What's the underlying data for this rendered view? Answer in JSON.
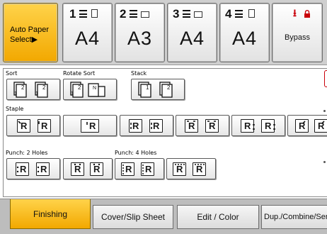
{
  "trays": [
    {
      "label": "Auto Paper\nSelect▶"
    },
    {
      "number": "1",
      "size": "A4"
    },
    {
      "number": "2",
      "size": "A3"
    },
    {
      "number": "3",
      "size": "A4"
    },
    {
      "number": "4",
      "size": "A4"
    },
    {
      "label": "Bypass",
      "icon": "bypass-arrow-icon"
    }
  ],
  "groups": {
    "sort": "Sort",
    "rotate_sort": "Rotate Sort",
    "stack": "Stack",
    "staple": "Staple",
    "punch2": "Punch: 2 Holes",
    "punch4": "Punch: 4 Holes"
  },
  "tabs": [
    {
      "label": "Finishing",
      "selected": true
    },
    {
      "label": "Cover/Slip Sheet"
    },
    {
      "label": "Edit / Color"
    },
    {
      "label": "Dup./Combine/Ser"
    }
  ],
  "colors": {
    "selected": "#f2a800",
    "bypass_red": "#c9000a"
  }
}
